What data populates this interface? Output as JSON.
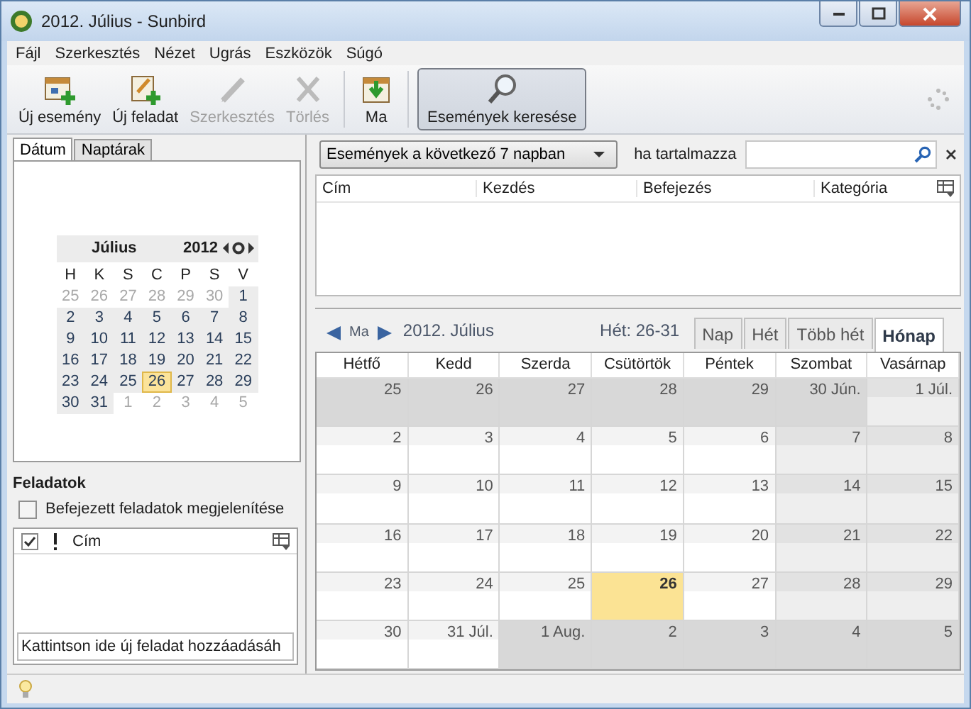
{
  "window": {
    "title": "2012. Július - Sunbird"
  },
  "menu": [
    "Fájl",
    "Szerkesztés",
    "Nézet",
    "Ugrás",
    "Eszközök",
    "Súgó"
  ],
  "toolbar": [
    {
      "label": "Új esemény",
      "kind": "new-event",
      "disabled": false,
      "selected": false
    },
    {
      "label": "Új feladat",
      "kind": "new-task",
      "disabled": false,
      "selected": false
    },
    {
      "label": "Szerkesztés",
      "kind": "edit",
      "disabled": true,
      "selected": false
    },
    {
      "label": "Törlés",
      "kind": "delete",
      "disabled": true,
      "selected": false
    },
    {
      "label": "Ma",
      "kind": "today",
      "disabled": false,
      "selected": false
    },
    {
      "label": "Események keresése",
      "kind": "search",
      "disabled": false,
      "selected": true
    }
  ],
  "sidebar_tabs": [
    {
      "label": "Dátum",
      "selected": true
    },
    {
      "label": "Naptárak",
      "selected": false
    }
  ],
  "mini_calendar": {
    "month": "Július",
    "year": "2012",
    "weekdays": [
      "H",
      "K",
      "S",
      "C",
      "P",
      "S",
      "V"
    ],
    "days": [
      {
        "label": "25",
        "muted": true,
        "today": false
      },
      {
        "label": "26",
        "muted": true,
        "today": false
      },
      {
        "label": "27",
        "muted": true,
        "today": false
      },
      {
        "label": "28",
        "muted": true,
        "today": false
      },
      {
        "label": "29",
        "muted": true,
        "today": false
      },
      {
        "label": "30",
        "muted": true,
        "today": false
      },
      {
        "label": "1",
        "muted": false,
        "today": false
      },
      {
        "label": "2",
        "muted": false,
        "today": false
      },
      {
        "label": "3",
        "muted": false,
        "today": false
      },
      {
        "label": "4",
        "muted": false,
        "today": false
      },
      {
        "label": "5",
        "muted": false,
        "today": false
      },
      {
        "label": "6",
        "muted": false,
        "today": false
      },
      {
        "label": "7",
        "muted": false,
        "today": false
      },
      {
        "label": "8",
        "muted": false,
        "today": false
      },
      {
        "label": "9",
        "muted": false,
        "today": false
      },
      {
        "label": "10",
        "muted": false,
        "today": false
      },
      {
        "label": "11",
        "muted": false,
        "today": false
      },
      {
        "label": "12",
        "muted": false,
        "today": false
      },
      {
        "label": "13",
        "muted": false,
        "today": false
      },
      {
        "label": "14",
        "muted": false,
        "today": false
      },
      {
        "label": "15",
        "muted": false,
        "today": false
      },
      {
        "label": "16",
        "muted": false,
        "today": false
      },
      {
        "label": "17",
        "muted": false,
        "today": false
      },
      {
        "label": "18",
        "muted": false,
        "today": false
      },
      {
        "label": "19",
        "muted": false,
        "today": false
      },
      {
        "label": "20",
        "muted": false,
        "today": false
      },
      {
        "label": "21",
        "muted": false,
        "today": false
      },
      {
        "label": "22",
        "muted": false,
        "today": false
      },
      {
        "label": "23",
        "muted": false,
        "today": false
      },
      {
        "label": "24",
        "muted": false,
        "today": false
      },
      {
        "label": "25",
        "muted": false,
        "today": false
      },
      {
        "label": "26",
        "muted": false,
        "today": true
      },
      {
        "label": "27",
        "muted": false,
        "today": false
      },
      {
        "label": "28",
        "muted": false,
        "today": false
      },
      {
        "label": "29",
        "muted": false,
        "today": false
      },
      {
        "label": "30",
        "muted": false,
        "today": false
      },
      {
        "label": "31",
        "muted": false,
        "today": false
      },
      {
        "label": "1",
        "muted": true,
        "today": false
      },
      {
        "label": "2",
        "muted": true,
        "today": false
      },
      {
        "label": "3",
        "muted": true,
        "today": false
      },
      {
        "label": "4",
        "muted": true,
        "today": false
      },
      {
        "label": "5",
        "muted": true,
        "today": false
      }
    ]
  },
  "tasks": {
    "title": "Feladatok",
    "show_completed": {
      "label": "Befejezett feladatok megjelenítése",
      "checked": false
    },
    "column": "Cím",
    "new_task_placeholder": "Kattintson ide új feladat hozzáadásáh"
  },
  "filter": {
    "range": "Események a következő 7 napban",
    "contains_label": "ha tartalmazza"
  },
  "event_list": {
    "columns": [
      "Cím",
      "Kezdés",
      "Befejezés",
      "Kategória"
    ]
  },
  "nav": {
    "today": "Ma",
    "title": "2012. Július",
    "week": "Hét: 26-31"
  },
  "view_tabs": [
    {
      "label": "Nap",
      "selected": false
    },
    {
      "label": "Hét",
      "selected": false
    },
    {
      "label": "Több hét",
      "selected": false
    },
    {
      "label": "Hónap",
      "selected": true
    }
  ],
  "month": {
    "weekdays": [
      "Hétfő",
      "Kedd",
      "Szerda",
      "Csütörtök",
      "Péntek",
      "Szombat",
      "Vasárnap"
    ],
    "rows": [
      [
        {
          "label": "25",
          "muted": true,
          "today": false
        },
        {
          "label": "26",
          "muted": true,
          "today": false
        },
        {
          "label": "27",
          "muted": true,
          "today": false
        },
        {
          "label": "28",
          "muted": true,
          "today": false
        },
        {
          "label": "29",
          "muted": true,
          "today": false
        },
        {
          "label": "30 Jún.",
          "muted": true,
          "today": false
        },
        {
          "label": "1 Júl.",
          "muted": false,
          "today": false
        }
      ],
      [
        {
          "label": "2",
          "muted": false,
          "today": false
        },
        {
          "label": "3",
          "muted": false,
          "today": false
        },
        {
          "label": "4",
          "muted": false,
          "today": false
        },
        {
          "label": "5",
          "muted": false,
          "today": false
        },
        {
          "label": "6",
          "muted": false,
          "today": false
        },
        {
          "label": "7",
          "muted": false,
          "today": false
        },
        {
          "label": "8",
          "muted": false,
          "today": false
        }
      ],
      [
        {
          "label": "9",
          "muted": false,
          "today": false
        },
        {
          "label": "10",
          "muted": false,
          "today": false
        },
        {
          "label": "11",
          "muted": false,
          "today": false
        },
        {
          "label": "12",
          "muted": false,
          "today": false
        },
        {
          "label": "13",
          "muted": false,
          "today": false
        },
        {
          "label": "14",
          "muted": false,
          "today": false
        },
        {
          "label": "15",
          "muted": false,
          "today": false
        }
      ],
      [
        {
          "label": "16",
          "muted": false,
          "today": false
        },
        {
          "label": "17",
          "muted": false,
          "today": false
        },
        {
          "label": "18",
          "muted": false,
          "today": false
        },
        {
          "label": "19",
          "muted": false,
          "today": false
        },
        {
          "label": "20",
          "muted": false,
          "today": false
        },
        {
          "label": "21",
          "muted": false,
          "today": false
        },
        {
          "label": "22",
          "muted": false,
          "today": false
        }
      ],
      [
        {
          "label": "23",
          "muted": false,
          "today": false
        },
        {
          "label": "24",
          "muted": false,
          "today": false
        },
        {
          "label": "25",
          "muted": false,
          "today": false
        },
        {
          "label": "26",
          "muted": false,
          "today": true
        },
        {
          "label": "27",
          "muted": false,
          "today": false
        },
        {
          "label": "28",
          "muted": false,
          "today": false
        },
        {
          "label": "29",
          "muted": false,
          "today": false
        }
      ],
      [
        {
          "label": "30",
          "muted": false,
          "today": false
        },
        {
          "label": "31 Júl.",
          "muted": false,
          "today": false
        },
        {
          "label": "1 Aug.",
          "muted": true,
          "today": false
        },
        {
          "label": "2",
          "muted": true,
          "today": false
        },
        {
          "label": "3",
          "muted": true,
          "today": false
        },
        {
          "label": "4",
          "muted": true,
          "today": false
        },
        {
          "label": "5",
          "muted": true,
          "today": false
        }
      ]
    ]
  }
}
